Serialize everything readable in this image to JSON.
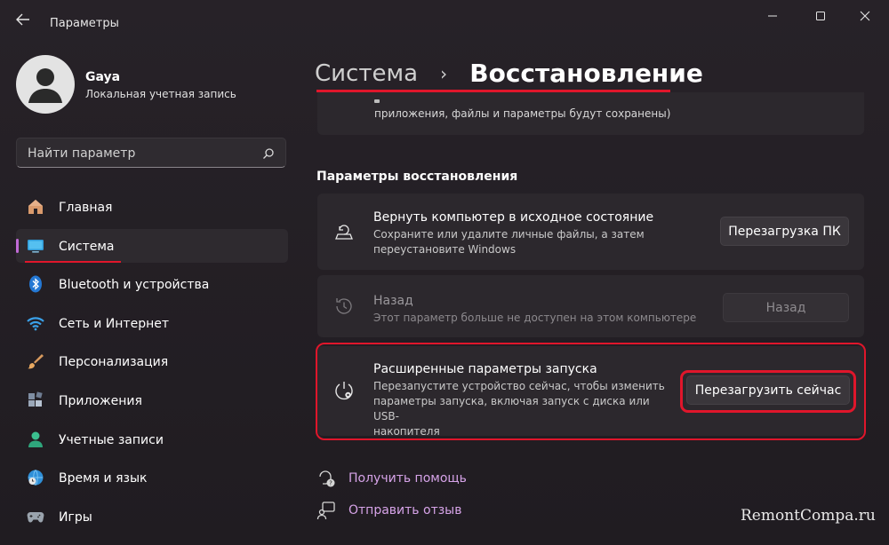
{
  "window": {
    "title": "Параметры"
  },
  "profile": {
    "name": "Gaya",
    "account_type": "Локальная учетная запись"
  },
  "search": {
    "placeholder": "Найти параметр"
  },
  "sidebar": {
    "items": [
      {
        "label": "Главная",
        "icon": "home-icon"
      },
      {
        "label": "Система",
        "icon": "monitor-icon",
        "active": true
      },
      {
        "label": "Bluetooth и устройства",
        "icon": "bluetooth-icon"
      },
      {
        "label": "Сеть и Интернет",
        "icon": "wifi-icon"
      },
      {
        "label": "Персонализация",
        "icon": "brush-icon"
      },
      {
        "label": "Приложения",
        "icon": "apps-icon"
      },
      {
        "label": "Учетные записи",
        "icon": "user-icon"
      },
      {
        "label": "Время и язык",
        "icon": "globe-clock-icon"
      },
      {
        "label": "Игры",
        "icon": "gamepad-icon"
      }
    ]
  },
  "breadcrumb": {
    "parent": "Система",
    "current": "Восстановление"
  },
  "partial_card": {
    "text": "приложения, файлы и параметры будут сохранены)"
  },
  "recovery": {
    "section_title": "Параметры восстановления",
    "reset": {
      "title": "Вернуть компьютер в исходное состояние",
      "desc_line1": "Сохраните или удалите личные файлы, а затем",
      "desc_line2": "переустановите Windows",
      "button": "Перезагрузка ПК"
    },
    "goback": {
      "title": "Назад",
      "desc": "Этот параметр больше не доступен на этом компьютере",
      "button": "Назад"
    },
    "advanced": {
      "title": "Расширенные параметры запуска",
      "desc_line1": "Перезапустите устройство сейчас, чтобы изменить",
      "desc_line2": "параметры запуска, включая запуск с диска или USB-",
      "desc_line3": "накопителя",
      "button": "Перезагрузить сейчас"
    }
  },
  "links": {
    "help": "Получить помощь",
    "feedback": "Отправить отзыв"
  },
  "watermark": "RemontCompa.ru",
  "colors": {
    "accent": "#c06ad6",
    "highlight": "#e0162b",
    "link": "#d6a3e8"
  }
}
